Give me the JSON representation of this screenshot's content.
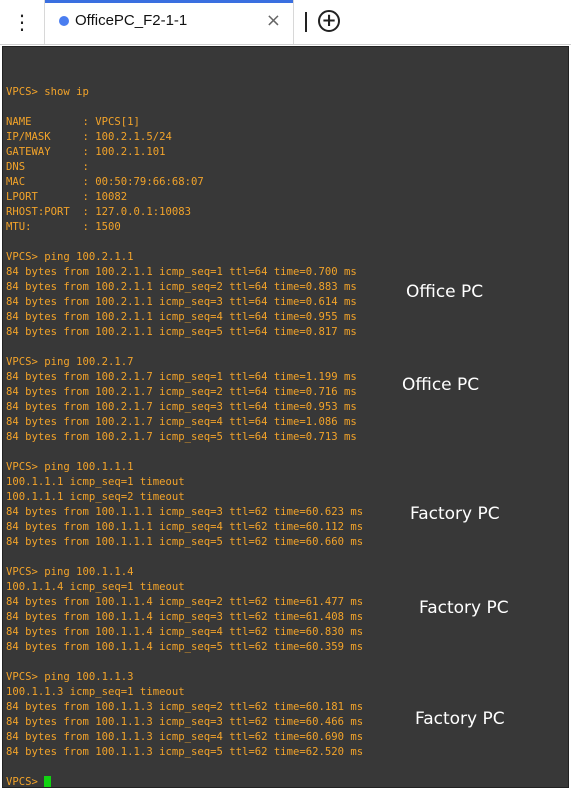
{
  "tab": {
    "title": "OfficePC_F2-1-1",
    "close": "×",
    "new_tab": "+",
    "menu": "⋮"
  },
  "terminal": {
    "lines": [
      "",
      "VPCS> show ip",
      "",
      "NAME        : VPCS[1]",
      "IP/MASK     : 100.2.1.5/24",
      "GATEWAY     : 100.2.1.101",
      "DNS         :",
      "MAC         : 00:50:79:66:68:07",
      "LPORT       : 10082",
      "RHOST:PORT  : 127.0.0.1:10083",
      "MTU:        : 1500",
      "",
      "VPCS> ping 100.2.1.1",
      "84 bytes from 100.2.1.1 icmp_seq=1 ttl=64 time=0.700 ms",
      "84 bytes from 100.2.1.1 icmp_seq=2 ttl=64 time=0.883 ms",
      "84 bytes from 100.2.1.1 icmp_seq=3 ttl=64 time=0.614 ms",
      "84 bytes from 100.2.1.1 icmp_seq=4 ttl=64 time=0.955 ms",
      "84 bytes from 100.2.1.1 icmp_seq=5 ttl=64 time=0.817 ms",
      "",
      "VPCS> ping 100.2.1.7",
      "84 bytes from 100.2.1.7 icmp_seq=1 ttl=64 time=1.199 ms",
      "84 bytes from 100.2.1.7 icmp_seq=2 ttl=64 time=0.716 ms",
      "84 bytes from 100.2.1.7 icmp_seq=3 ttl=64 time=0.953 ms",
      "84 bytes from 100.2.1.7 icmp_seq=4 ttl=64 time=1.086 ms",
      "84 bytes from 100.2.1.7 icmp_seq=5 ttl=64 time=0.713 ms",
      "",
      "VPCS> ping 100.1.1.1",
      "100.1.1.1 icmp_seq=1 timeout",
      "100.1.1.1 icmp_seq=2 timeout",
      "84 bytes from 100.1.1.1 icmp_seq=3 ttl=62 time=60.623 ms",
      "84 bytes from 100.1.1.1 icmp_seq=4 ttl=62 time=60.112 ms",
      "84 bytes from 100.1.1.1 icmp_seq=5 ttl=62 time=60.660 ms",
      "",
      "VPCS> ping 100.1.1.4",
      "100.1.1.4 icmp_seq=1 timeout",
      "84 bytes from 100.1.1.4 icmp_seq=2 ttl=62 time=61.477 ms",
      "84 bytes from 100.1.1.4 icmp_seq=3 ttl=62 time=61.408 ms",
      "84 bytes from 100.1.1.4 icmp_seq=4 ttl=62 time=60.830 ms",
      "84 bytes from 100.1.1.4 icmp_seq=5 ttl=62 time=60.359 ms",
      "",
      "VPCS> ping 100.1.1.3",
      "100.1.1.3 icmp_seq=1 timeout",
      "84 bytes from 100.1.1.3 icmp_seq=2 ttl=62 time=60.181 ms",
      "84 bytes from 100.1.1.3 icmp_seq=3 ttl=62 time=60.466 ms",
      "84 bytes from 100.1.1.3 icmp_seq=4 ttl=62 time=60.690 ms",
      "84 bytes from 100.1.1.3 icmp_seq=5 ttl=62 time=62.520 ms",
      ""
    ],
    "prompt": "VPCS>"
  },
  "annotations": {
    "a1": "Office PC",
    "a2": "Office PC",
    "a3": "Factory PC",
    "a4": "Factory PC",
    "a5": "Factory PC"
  },
  "colors": {
    "terminal_bg": "#383838",
    "terminal_text": "#f2a32a",
    "cursor": "#11d311",
    "tab_accent": "#3a6fe0"
  }
}
